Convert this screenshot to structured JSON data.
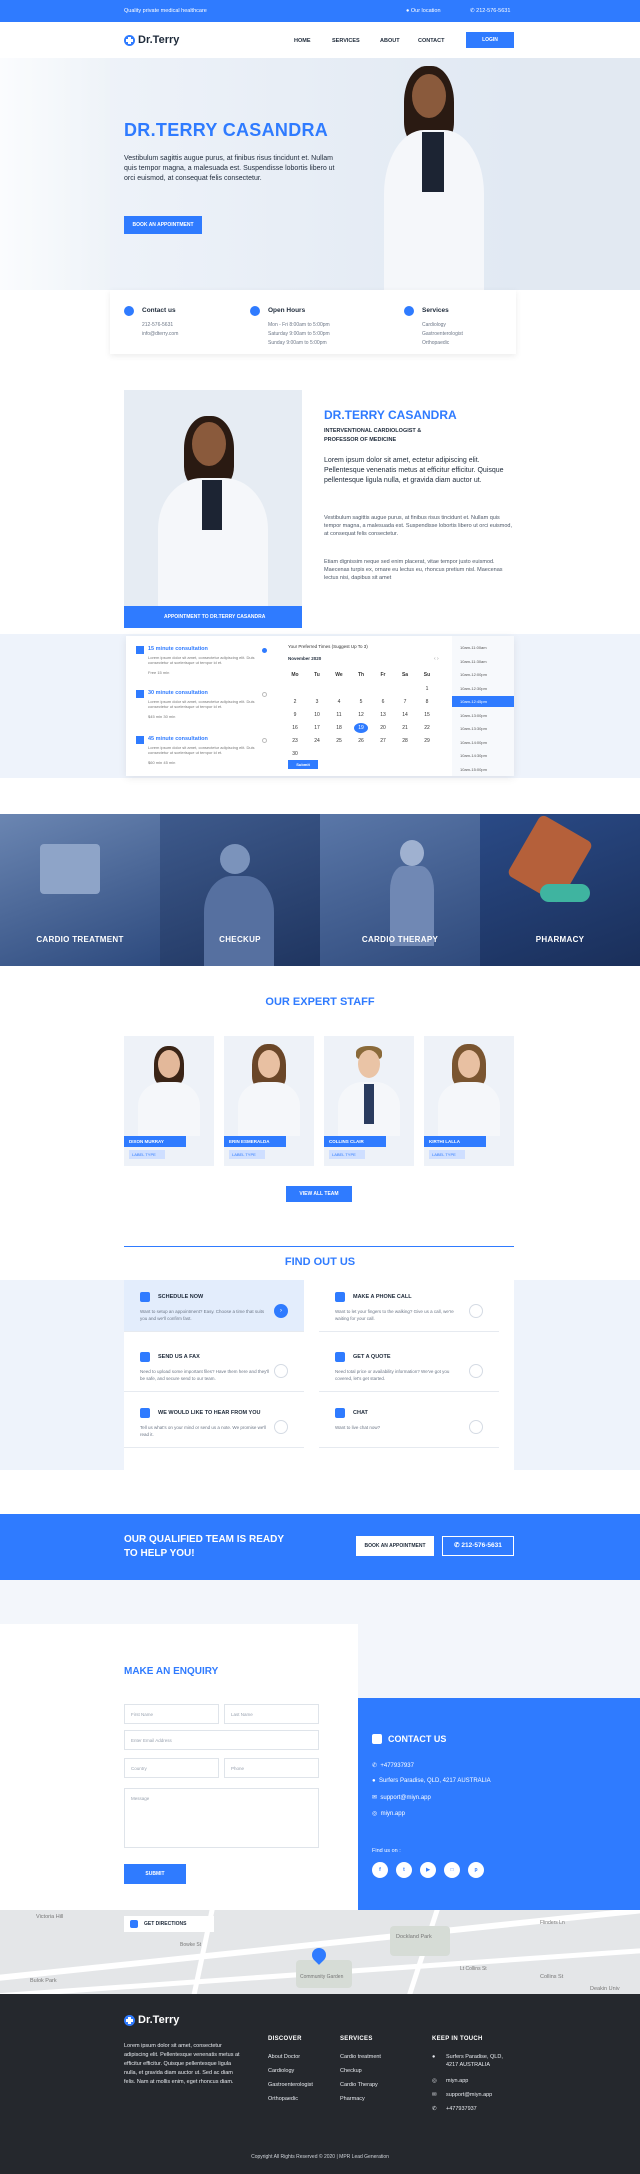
{
  "topbar": {
    "tagline": "Quality private medical healthcare",
    "location": "Our location",
    "phone": "212-576-5631"
  },
  "brand": {
    "name": "Dr.Terry"
  },
  "nav": {
    "items": [
      "HOME",
      "SERVICES",
      "ABOUT",
      "CONTACT"
    ],
    "login": "LOGIN"
  },
  "hero": {
    "title": "DR.TERRY CASANDRA",
    "text": "Vestibulum sagittis augue purus, at finibus risus tincidunt et. Nullam quis tempor magna, a malesuada est. Suspendisse lobortis libero ut orci euismod, at consequat felis consectetur.",
    "button": "BOOK AN APPOINTMENT"
  },
  "info": [
    {
      "title": "Contact us",
      "lines": [
        "212-576-5631",
        "info@dterry.com"
      ]
    },
    {
      "title": "Open Hours",
      "lines": [
        "Mon - Fri 8:00am to 5:00pm",
        "Saturday 9:00am to 5:00pm",
        "Sunday 9:00am to 5:00pm"
      ]
    },
    {
      "title": "Services",
      "lines": [
        "Cardiology",
        "Gastroenterologist",
        "Orthopaedic"
      ]
    }
  ],
  "about": {
    "title": "DR.TERRY CASANDRA",
    "subtitle1": "INTERVENTIONAL CARDIOLOGIST &",
    "subtitle2": "PROFESSOR OF MEDICINE",
    "lead": "Lorem ipsum dolor sit amet, ectetur adipiscing elit. Pellentesque venenatis metus at efficitur efficitur. Quisque pellentesque ligula nulla, et gravida diam auctor ut.",
    "p1": "Vestibulum sagittis augue purus, at finibus risus tincidunt et. Nullam quis tempor magna, a malesuada est. Suspendisse lobortis libero ut orci euismod, at consequat felis consectetur.",
    "p2": "Etiam dignissim neque sed enim placerat, vitae tempor justo euismod. Maecenas turpis ex, ornare eu lectus eu, rhoncus pretium nisl. Maecenas lectus nisi, dapibus sit amet",
    "appt_button": "APPOINTMENT TO DR.TERRY CASANDRA"
  },
  "booking": {
    "sessions": [
      {
        "title": "15 minute consultation",
        "text": "Lorem ipsum dolor sit amet, consectetur adipiscing elit. Duis consectetur ut scelerisque ut tempor id et.",
        "meta": "Free   15 min"
      },
      {
        "title": "30 minute consultation",
        "text": "Lorem ipsum dolor sit amet, consectetur adipiscing elit. Duis consectetur ut scelerisque ut tempor id et.",
        "meta": "$45 min   30 min"
      },
      {
        "title": "45 minute consultation",
        "text": "Lorem ipsum dolor sit amet, consectetur adipiscing elit. Duis consectetur ut scelerisque ut tempor id et.",
        "meta": "$60 min   45 min"
      }
    ],
    "cal_caption": "Your Preferred Times (Suggest Up To 3)",
    "month": "November 2020",
    "weekdays": [
      "Mo",
      "Tu",
      "We",
      "Th",
      "Fr",
      "Sa",
      "Su"
    ],
    "days": [
      "",
      "",
      "",
      "",
      "",
      "",
      "1",
      "2",
      "3",
      "4",
      "5",
      "6",
      "7",
      "8",
      "9",
      "10",
      "11",
      "12",
      "13",
      "14",
      "15",
      "16",
      "17",
      "18",
      "19",
      "20",
      "21",
      "22",
      "23",
      "24",
      "25",
      "26",
      "27",
      "28",
      "29",
      "30"
    ],
    "selected_day": "19",
    "submit": "Submit",
    "times": [
      "10am-11:00am",
      "10am-11:30am",
      "10am-12:00pm",
      "10am-12:30pm",
      "10am-12:45pm",
      "10am-13:00pm",
      "10am-13:30pm",
      "10am-14:00pm",
      "10am-14:30pm",
      "10am-15:00pm"
    ]
  },
  "services": [
    "CARDIO TREATMENT",
    "CHECKUP",
    "CARDIO THERAPY",
    "PHARMACY"
  ],
  "staff": {
    "title": "OUR EXPERT STAFF",
    "members": [
      {
        "name": "DIXON MURRAY",
        "tag": "LABEL TYPE"
      },
      {
        "name": "ERIN ESMERALDA",
        "tag": "LABEL TYPE"
      },
      {
        "name": "COLLINS CLAIR",
        "tag": "LABEL TYPE"
      },
      {
        "name": "KIRTHI LALLA",
        "tag": "LABEL TYPE"
      }
    ],
    "button": "VIEW ALL TEAM"
  },
  "findout": {
    "title": "FIND OUT US",
    "cards": [
      {
        "title": "SCHEDULE NOW",
        "text": "Want to setup an appointment? Easy. Choose a time that suits you and we'll confirm fast."
      },
      {
        "title": "MAKE A PHONE CALL",
        "text": "Want to let your fingers to the walking? Give us a call, we're waiting for your call."
      },
      {
        "title": "SEND US A FAX",
        "text": "Need to upload some important files? Have them here and they'll be safe, and secure send to our team."
      },
      {
        "title": "GET A QUOTE",
        "text": "Need total price or availability information? We've got you covered, let's get started."
      },
      {
        "title": "WE WOULD LIKE TO HEAR FROM YOU",
        "text": "Tell us what's on your mind or send us a note. We promise we'll read it."
      },
      {
        "title": "CHAT",
        "text": "Want to live chat now?"
      }
    ]
  },
  "cta": {
    "line1": "OUR QUALIFIED TEAM IS READY",
    "line2": "TO HELP YOU!",
    "button": "BOOK AN APPOINTMENT",
    "phone": "212-576-5631"
  },
  "enquiry": {
    "title": "MAKE AN ENQUIRY",
    "first": "First Name",
    "last": "Last Name",
    "email": "Enter Email Address",
    "country": "Country",
    "phone": "Phone",
    "message": "Message",
    "submit": "SUBMIT"
  },
  "contact": {
    "title": "CONTACT US",
    "phone": "+477937937",
    "address": "Surfers Paradise, QLD, 4217 AUSTRALIA",
    "email": "support@miyn.app",
    "web": "miyn.app",
    "find": "Find us on :"
  },
  "map": {
    "directions": "GET DIRECTIONS",
    "labels": [
      "Victoria Hill",
      "Bulok Park",
      "Bowke St",
      "Dockland Park",
      "Community Garden",
      "Collins St",
      "Deakin Univ",
      "Flinders Ln",
      "Lt Collins St"
    ]
  },
  "footer": {
    "about": "Lorem ipsum dolor sit amet, consectetur adipiscing elit. Pellentesque venenatis metus at efficitur efficitur. Quisque pellentesque ligula nulla, et gravida diam auctor ut. Sed ac diam felis. Nam at mollis enim, eget rhoncus diam.",
    "discover": {
      "title": "DISCOVER",
      "items": [
        "About Doctor",
        "Cardiology",
        "Gastroenterologist",
        "Orthopaedic"
      ]
    },
    "services": {
      "title": "SERVICES",
      "items": [
        "Cardio treatment",
        "Checkup",
        "Cardio Therapy",
        "Pharmacy"
      ]
    },
    "touch": {
      "title": "KEEP IN TOUCH",
      "address1": "Surfers Paradise, QLD,",
      "address2": "4217 AUSTRALIA",
      "web": "miyn.app",
      "email": "support@miyn.app",
      "phone": "+477937937"
    },
    "copyright": "Copyright All Rights Reserved © 2020 | MPR Lead Generation"
  },
  "colors": {
    "accent": "#2f7bff",
    "footer": "#25282d"
  }
}
